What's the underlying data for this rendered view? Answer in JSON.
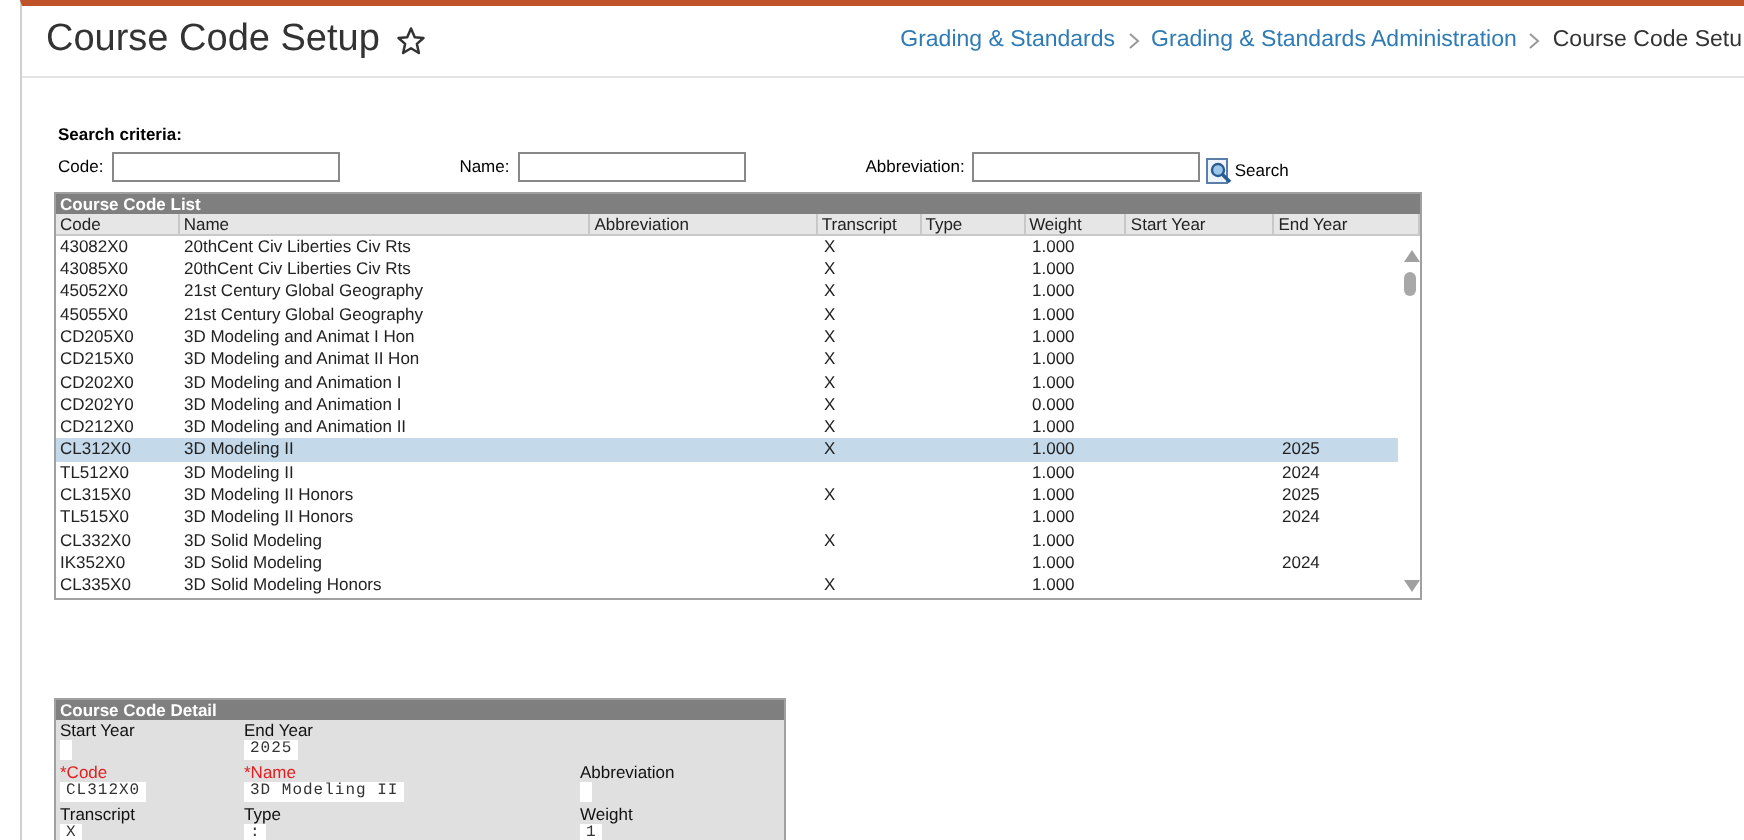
{
  "page": {
    "title": "Course Code Setup",
    "favorite": false
  },
  "breadcrumb": [
    {
      "label": "Grading & Standards",
      "link": true
    },
    {
      "label": "Grading & Standards Administration",
      "link": true
    },
    {
      "label": "Course Code Setu",
      "link": false
    }
  ],
  "search": {
    "heading": "Search criteria:",
    "fields": [
      {
        "label": "Code:"
      },
      {
        "label": "Name:"
      },
      {
        "label": "Abbreviation:"
      }
    ],
    "button": "Search"
  },
  "list": {
    "title": "Course Code List",
    "columns": [
      "Code",
      "Name",
      "Abbreviation",
      "Transcript",
      "Type",
      "Weight",
      "Start Year",
      "End Year"
    ],
    "rows": [
      {
        "cells": [
          "43082X0",
          "20thCent Civ Liberties Civ Rts",
          "",
          "X",
          "",
          "1.000",
          "",
          ""
        ],
        "selected": false
      },
      {
        "cells": [
          "43085X0",
          "20thCent Civ Liberties Civ Rts",
          "",
          "X",
          "",
          "1.000",
          "",
          ""
        ],
        "selected": false
      },
      {
        "cells": [
          "45052X0",
          "21st Century Global Geography",
          "",
          "X",
          "",
          "1.000",
          "",
          ""
        ],
        "selected": false
      },
      {
        "cells": [
          "45055X0",
          "21st Century Global Geography",
          "",
          "X",
          "",
          "1.000",
          "",
          ""
        ],
        "selected": false
      },
      {
        "cells": [
          "CD205X0",
          "3D Modeling and Animat I Hon",
          "",
          "X",
          "",
          "1.000",
          "",
          ""
        ],
        "selected": false
      },
      {
        "cells": [
          "CD215X0",
          "3D Modeling and Animat II Hon",
          "",
          "X",
          "",
          "1.000",
          "",
          ""
        ],
        "selected": false
      },
      {
        "cells": [
          "CD202X0",
          "3D Modeling and Animation I",
          "",
          "X",
          "",
          "1.000",
          "",
          ""
        ],
        "selected": false
      },
      {
        "cells": [
          "CD202Y0",
          "3D Modeling and Animation I",
          "",
          "X",
          "",
          "0.000",
          "",
          ""
        ],
        "selected": false
      },
      {
        "cells": [
          "CD212X0",
          "3D Modeling and Animation II",
          "",
          "X",
          "",
          "1.000",
          "",
          ""
        ],
        "selected": false
      },
      {
        "cells": [
          "CL312X0",
          "3D Modeling II",
          "",
          "X",
          "",
          "1.000",
          "",
          "2025"
        ],
        "selected": true
      },
      {
        "cells": [
          "TL512X0",
          "3D Modeling II",
          "",
          "",
          "",
          "1.000",
          "",
          "2024"
        ],
        "selected": false
      },
      {
        "cells": [
          "CL315X0",
          "3D Modeling II Honors",
          "",
          "X",
          "",
          "1.000",
          "",
          "2025"
        ],
        "selected": false
      },
      {
        "cells": [
          "TL515X0",
          "3D Modeling II Honors",
          "",
          "",
          "",
          "1.000",
          "",
          "2024"
        ],
        "selected": false
      },
      {
        "cells": [
          "CL332X0",
          "3D Solid Modeling",
          "",
          "X",
          "",
          "1.000",
          "",
          ""
        ],
        "selected": false
      },
      {
        "cells": [
          "IK352X0",
          "3D Solid Modeling",
          "",
          "",
          "",
          "1.000",
          "",
          "2024"
        ],
        "selected": false
      },
      {
        "cells": [
          "CL335X0",
          "3D Solid Modeling Honors",
          "",
          "X",
          "",
          "1.000",
          "",
          ""
        ],
        "selected": false
      }
    ]
  },
  "detail": {
    "title": "Course Code Detail",
    "fields": [
      {
        "kind": "field",
        "label": "Start Year",
        "required": false
      },
      {
        "kind": "field",
        "label": "End Year",
        "value": "2025",
        "required": false
      },
      {
        "kind": "blank"
      },
      {
        "kind": "field",
        "label": "*Code",
        "value": "CL312X0",
        "required": true
      },
      {
        "kind": "field",
        "label": "*Name",
        "value": "3D Modeling II",
        "required": true
      },
      {
        "kind": "field",
        "label": "Abbreviation",
        "required": false
      },
      {
        "kind": "field",
        "label": "Transcript",
        "value": "X",
        "required": false
      },
      {
        "kind": "field",
        "label": "Type",
        "value": ":",
        "required": false
      },
      {
        "kind": "field",
        "label": "Weight",
        "value": "1",
        "required": false
      }
    ]
  }
}
